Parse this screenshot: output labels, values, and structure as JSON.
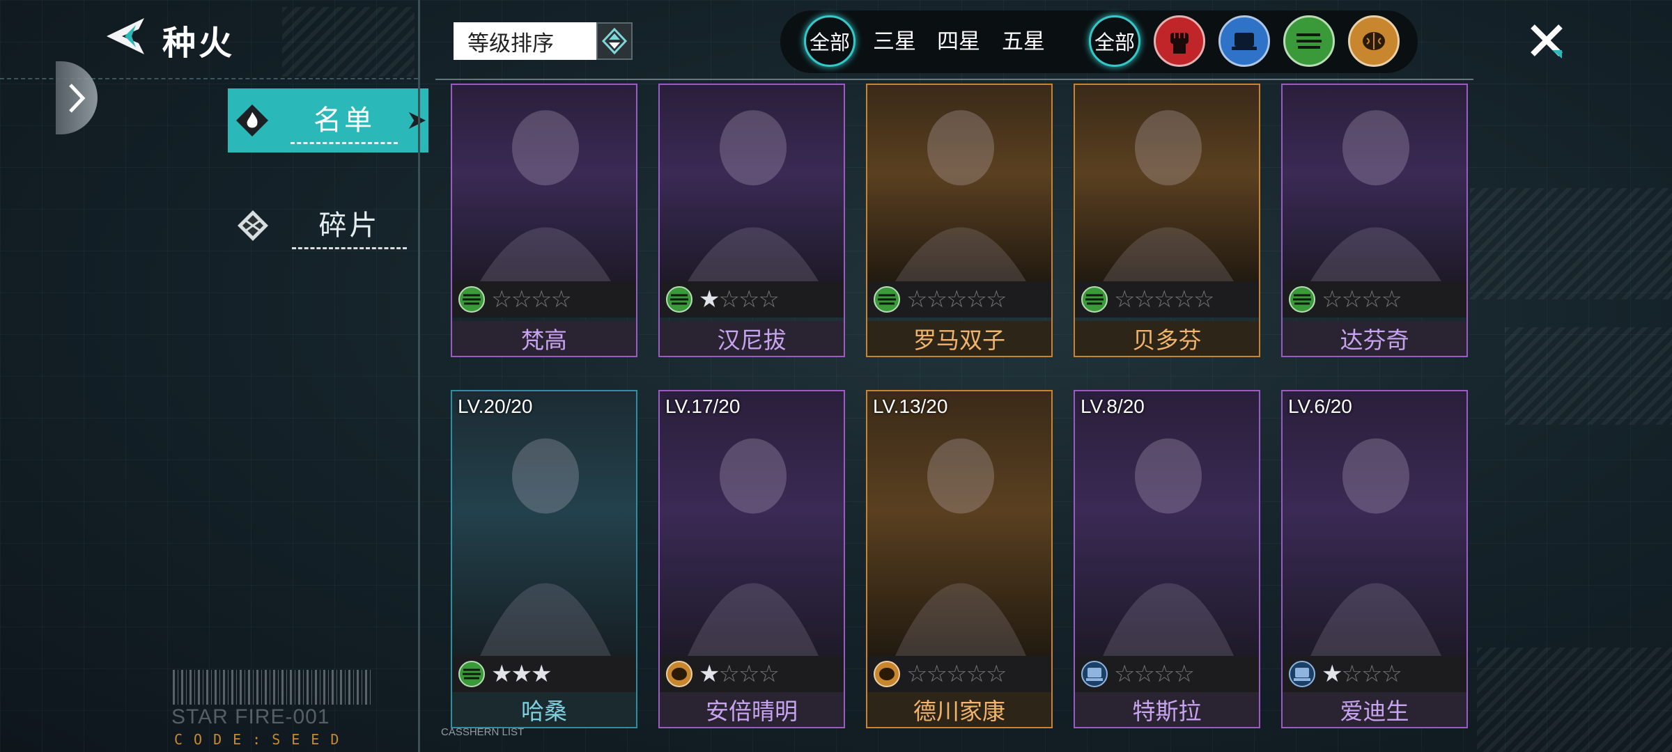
{
  "header": {
    "title": "种火",
    "sort_label": "等级排序"
  },
  "sidebar": {
    "tabs": [
      {
        "label": "名单",
        "icon": "flame-icon",
        "active": true
      },
      {
        "label": "碎片",
        "icon": "shard-icon",
        "active": false
      }
    ],
    "footer_title": "STAR FIRE-001",
    "footer_code": "CODE:SEED",
    "list_label": "CASSHERN LIST"
  },
  "filters": {
    "rarity": [
      "全部",
      "三星",
      "四星",
      "五星"
    ],
    "type_all": "全部",
    "types": [
      {
        "icon": "fist-icon",
        "color": "#c0252a"
      },
      {
        "icon": "chip-icon",
        "color": "#2f73c8"
      },
      {
        "icon": "wave-icon",
        "color": "#3a9a3a"
      },
      {
        "icon": "brain-icon",
        "color": "#c8872f"
      }
    ]
  },
  "colors": {
    "accent": "#2ab8b9",
    "card_purple": "#9a5bc4",
    "card_gold": "#c9852e",
    "card_teal": "#2e8fa0"
  },
  "cards": [
    {
      "name": "梵高",
      "level": "",
      "stars_total": 4,
      "stars_lit": 0,
      "type": "wave-icon",
      "rarity": "purple"
    },
    {
      "name": "汉尼拔",
      "level": "",
      "stars_total": 4,
      "stars_lit": 1,
      "type": "wave-icon",
      "rarity": "purple"
    },
    {
      "name": "罗马双子",
      "level": "",
      "stars_total": 5,
      "stars_lit": 0,
      "type": "wave-icon",
      "rarity": "gold"
    },
    {
      "name": "贝多芬",
      "level": "",
      "stars_total": 5,
      "stars_lit": 0,
      "type": "wave-icon",
      "rarity": "gold"
    },
    {
      "name": "达芬奇",
      "level": "",
      "stars_total": 4,
      "stars_lit": 0,
      "type": "wave-icon",
      "rarity": "purple"
    },
    {
      "name": "哈桑",
      "level": "LV.20/20",
      "stars_total": 3,
      "stars_lit": 3,
      "type": "wave-icon",
      "rarity": "teal"
    },
    {
      "name": "安倍晴明",
      "level": "LV.17/20",
      "stars_total": 4,
      "stars_lit": 1,
      "type": "brain-icon",
      "rarity": "purple"
    },
    {
      "name": "德川家康",
      "level": "LV.13/20",
      "stars_total": 5,
      "stars_lit": 0,
      "type": "brain-icon",
      "rarity": "gold"
    },
    {
      "name": "特斯拉",
      "level": "LV.8/20",
      "stars_total": 4,
      "stars_lit": 0,
      "type": "chip-icon",
      "rarity": "purple"
    },
    {
      "name": "爱迪生",
      "level": "LV.6/20",
      "stars_total": 4,
      "stars_lit": 1,
      "type": "chip-icon",
      "rarity": "purple"
    }
  ]
}
